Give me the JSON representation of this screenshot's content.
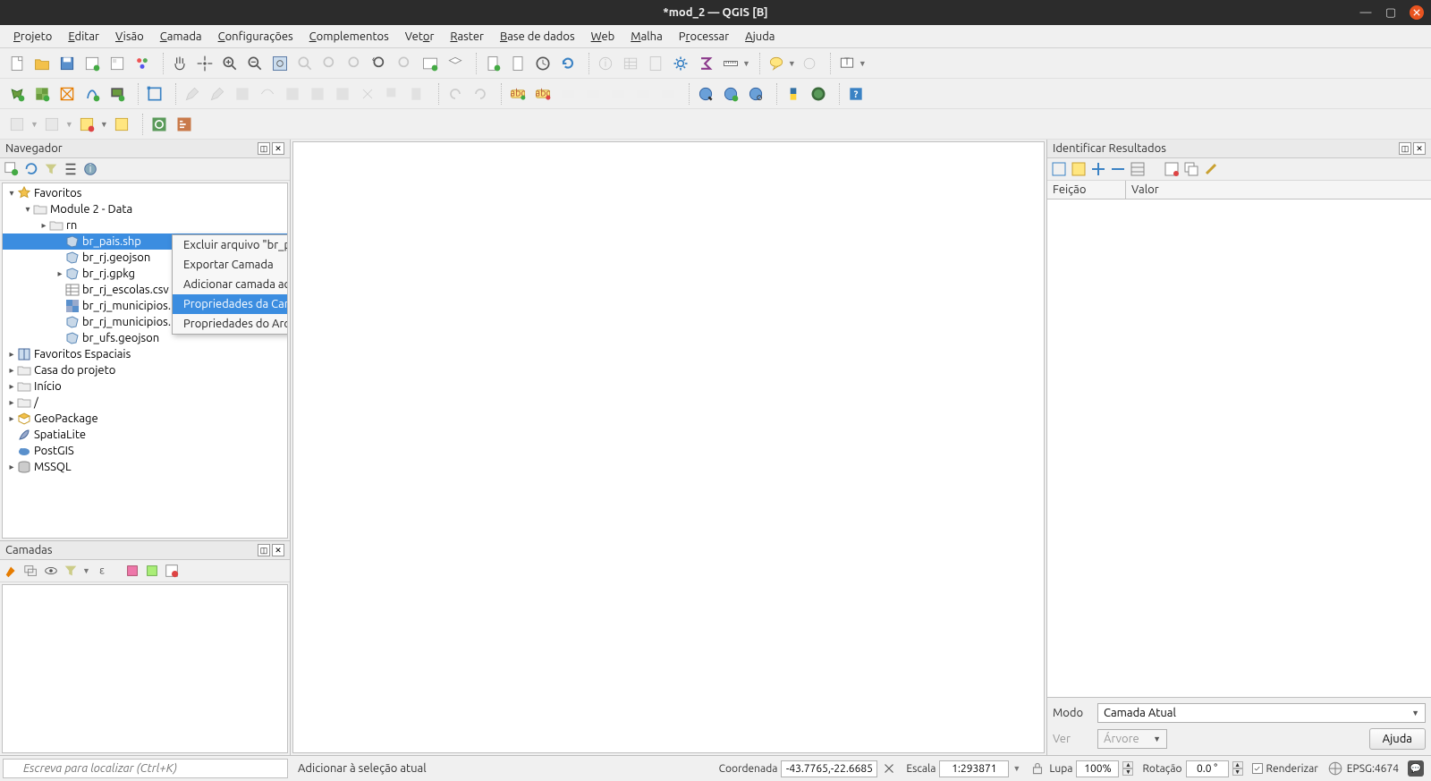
{
  "window": {
    "title": "*mod_2 — QGIS [B]"
  },
  "menu": {
    "items": [
      {
        "label": "Projeto",
        "ul": "P"
      },
      {
        "label": "Editar",
        "ul": "E"
      },
      {
        "label": "Visão",
        "ul": "V"
      },
      {
        "label": "Camada",
        "ul": "C"
      },
      {
        "label": "Configurações",
        "ul": "C"
      },
      {
        "label": "Complementos",
        "ul": "C"
      },
      {
        "label": "Vetor",
        "ul": "o"
      },
      {
        "label": "Raster",
        "ul": "R"
      },
      {
        "label": "Base de dados",
        "ul": "B"
      },
      {
        "label": "Web",
        "ul": "W"
      },
      {
        "label": "Malha",
        "ul": "M"
      },
      {
        "label": "Processar",
        "ul": "r"
      },
      {
        "label": "Ajuda",
        "ul": "A"
      }
    ]
  },
  "browser_panel": {
    "title": "Navegador",
    "tree": [
      {
        "label": "Favoritos",
        "level": 0,
        "expanded": true,
        "icon": "star"
      },
      {
        "label": "Module 2 - Data",
        "level": 1,
        "expanded": true,
        "icon": "folder"
      },
      {
        "label": "rn",
        "level": 2,
        "expanded": false,
        "icon": "folder",
        "toggle": true
      },
      {
        "label": "br_pais.shp",
        "level": 3,
        "icon": "polygon",
        "selected": true
      },
      {
        "label": "br_rj.geojson",
        "level": 3,
        "icon": "polygon"
      },
      {
        "label": "br_rj.gpkg",
        "level": 3,
        "icon": "polygon",
        "toggle": true
      },
      {
        "label": "br_rj_escolas.csv",
        "level": 3,
        "icon": "table"
      },
      {
        "label": "br_rj_municipios.k",
        "level": 3,
        "icon": "raster"
      },
      {
        "label": "br_rj_municipios.k",
        "level": 3,
        "icon": "polygon"
      },
      {
        "label": "br_ufs.geojson",
        "level": 3,
        "icon": "polygon"
      },
      {
        "label": "Favoritos Espaciais",
        "level": 0,
        "icon": "book",
        "toggle": true
      },
      {
        "label": "Casa do projeto",
        "level": 0,
        "icon": "folder",
        "toggle": true
      },
      {
        "label": "Início",
        "level": 0,
        "icon": "folder",
        "toggle": true
      },
      {
        "label": "/",
        "level": 0,
        "icon": "folder",
        "toggle": true
      },
      {
        "label": "GeoPackage",
        "level": 0,
        "icon": "geopackage",
        "toggle": true
      },
      {
        "label": "SpatiaLite",
        "level": 0,
        "icon": "feather"
      },
      {
        "label": "PostGIS",
        "level": 0,
        "icon": "elephant"
      },
      {
        "label": "MSSQL",
        "level": 0,
        "icon": "db",
        "toggle": true
      }
    ]
  },
  "context_menu": {
    "items": [
      {
        "label": "Excluir arquivo \"br_pais.shp\"…"
      },
      {
        "label": "Exportar Camada",
        "submenu": true
      },
      {
        "label": "Adicionar camada ao projeto"
      },
      {
        "label": "Propriedades da Camada…",
        "highlighted": true
      },
      {
        "label": "Propriedades do Arquivo…"
      }
    ]
  },
  "layers_panel": {
    "title": "Camadas"
  },
  "identify_panel": {
    "title": "Identificar Resultados",
    "col1": "Feição",
    "col2": "Valor",
    "mode_label": "Modo",
    "mode_value": "Camada Atual",
    "ver_label": "Ver",
    "ver_value": "Árvore",
    "help_label": "Ajuda"
  },
  "locator": {
    "placeholder": "Escreva para localizar (Ctrl+K)"
  },
  "statusbar": {
    "message": "Adicionar à seleção atual",
    "coord_label": "Coordenada",
    "coord_value": "-43.7765,-22.6685",
    "scale_label": "Escala",
    "scale_value": "1:293871",
    "lupa_label": "Lupa",
    "lupa_value": "100%",
    "rot_label": "Rotação",
    "rot_value": "0.0 °",
    "render_label": "Renderizar",
    "epsg_label": "EPSG:4674"
  }
}
